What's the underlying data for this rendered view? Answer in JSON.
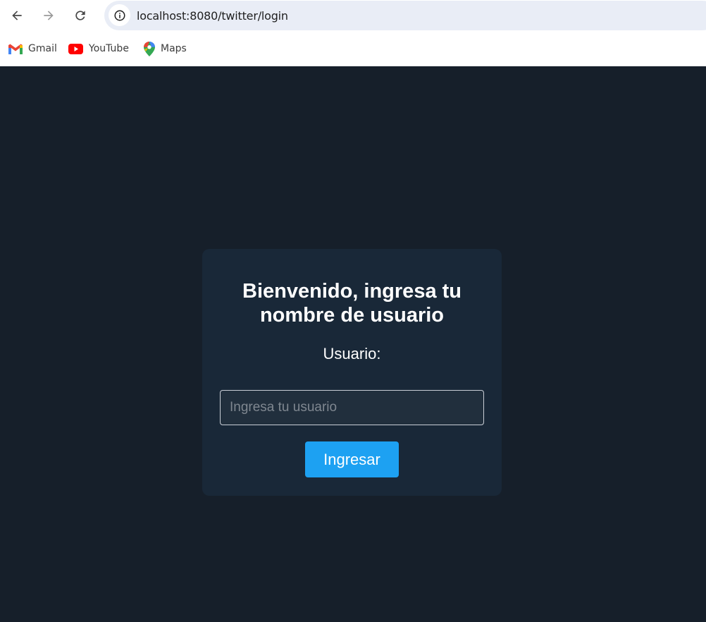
{
  "browser": {
    "url": "localhost:8080/twitter/login",
    "bookmarks": [
      {
        "label": "Gmail",
        "icon": "gmail-icon"
      },
      {
        "label": "YouTube",
        "icon": "youtube-icon"
      },
      {
        "label": "Maps",
        "icon": "maps-icon"
      }
    ]
  },
  "login": {
    "title_line1": "Bienvenido, ingresa tu",
    "title_line2": "nombre de usuario",
    "user_label": "Usuario:",
    "input_placeholder": "Ingresa tu usuario",
    "input_value": "",
    "submit_label": "Ingresar"
  },
  "colors": {
    "page_background": "#161f2a",
    "card_background": "#192838",
    "input_background": "#212f3d",
    "button_accent": "#1da1f2"
  }
}
